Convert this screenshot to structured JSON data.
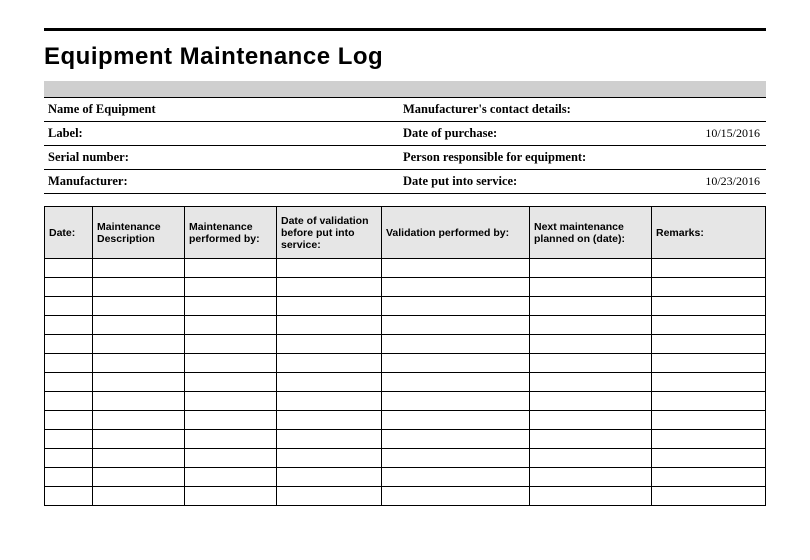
{
  "title": "Equipment Maintenance Log",
  "info": {
    "equipment_label": "Name of Equipment",
    "equipment_value": "",
    "mfg_contact_label": "Manufacturer's contact details:",
    "mfg_contact_value": "",
    "label_label": "Label:",
    "label_value": "",
    "date_purchase_label": "Date of purchase:",
    "date_purchase_value": "10/15/2016",
    "serial_label": "Serial number:",
    "serial_value": "",
    "responsible_label": "Person responsible for equipment:",
    "responsible_value": "",
    "manufacturer_label": "Manufacturer:",
    "manufacturer_value": "",
    "date_service_label": "Date put into service:",
    "date_service_value": "10/23/2016"
  },
  "columns": {
    "date": "Date:",
    "desc": "Maintenance Description",
    "perf": "Maintenance performed by:",
    "dval": "Date of validation before put into service:",
    "valby": "Validation performed by:",
    "next": "Next maintenance planned on (date):",
    "rem": "Remarks:"
  },
  "rows": 13
}
